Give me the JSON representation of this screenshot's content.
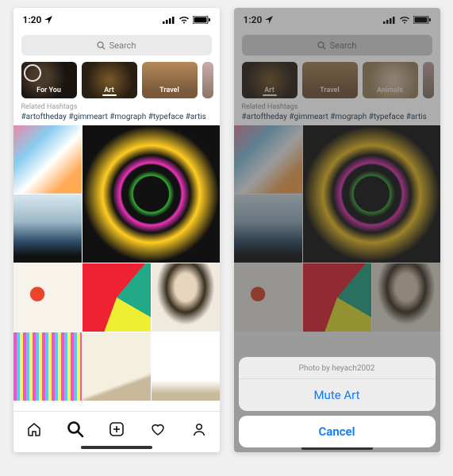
{
  "statusbar": {
    "time": "1:20"
  },
  "search": {
    "placeholder": "Search"
  },
  "left_screen": {
    "categories": [
      {
        "label": "For You",
        "kind": "foryou",
        "has_ring": true
      },
      {
        "label": "Art",
        "kind": "art",
        "active": true
      },
      {
        "label": "Travel",
        "kind": "travel"
      }
    ],
    "related_label": "Related Hashtags",
    "hashtags_line": "#artoftheday  #gimmeart  #mograph  #typeface  #artis"
  },
  "right_screen": {
    "categories": [
      {
        "label": "Art",
        "kind": "art",
        "active": true
      },
      {
        "label": "Travel",
        "kind": "travel"
      },
      {
        "label": "Animals",
        "kind": "animals"
      }
    ],
    "related_label": "Related Hashtags",
    "hashtags_line": "#artoftheday  #gimmeart  #mograph  #typeface  #artis",
    "actionsheet": {
      "header": "Photo by heyach2002",
      "action": "Mute Art",
      "cancel": "Cancel"
    }
  },
  "tabbar": {
    "items": [
      "home",
      "search",
      "add",
      "activity",
      "profile"
    ],
    "active": "search"
  }
}
